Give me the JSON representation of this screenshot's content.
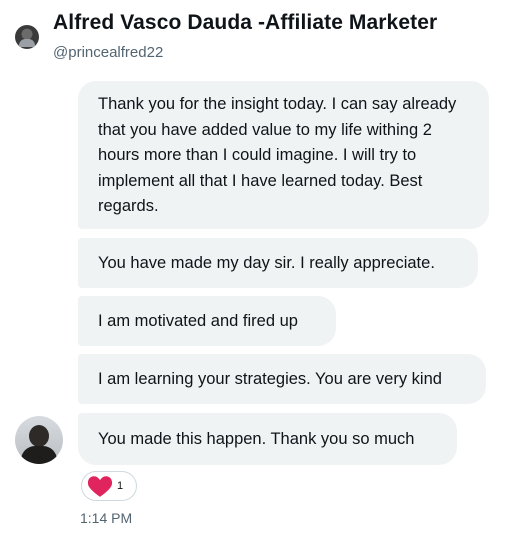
{
  "header": {
    "display_name": "Alfred Vasco Dauda -Affiliate Marketer",
    "handle": "@princealfred22"
  },
  "messages": [
    {
      "text": "Thank you for the insight today. I can say already that you have added value to my life withing 2 hours more than I could imagine. I will try to implement all that I have learned today. Best regards."
    },
    {
      "text": "You have made my day sir. I really appreciate."
    },
    {
      "text": "I am motivated and fired up"
    },
    {
      "text": "I am learning your strategies. You are very kind"
    },
    {
      "text": "You made this happen. Thank you so much"
    }
  ],
  "reaction": {
    "icon": "heart-icon",
    "count": "1",
    "color": "#e0245e"
  },
  "timestamp": "1:14 PM",
  "colors": {
    "bubble_bg": "#eff3f4",
    "secondary_text": "#536471"
  }
}
